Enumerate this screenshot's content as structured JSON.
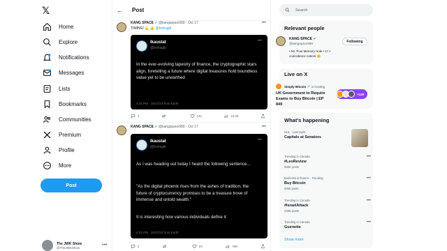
{
  "nav": {
    "logo": "𝕏",
    "items": [
      {
        "label": "Home",
        "icon": "home-icon"
      },
      {
        "label": "Explore",
        "icon": "search-icon"
      },
      {
        "label": "Notifications",
        "icon": "bell-icon"
      },
      {
        "label": "Messages",
        "icon": "mail-icon"
      },
      {
        "label": "Lists",
        "icon": "list-icon"
      },
      {
        "label": "Bookmarks",
        "icon": "bookmark-icon"
      },
      {
        "label": "Communities",
        "icon": "people-icon"
      },
      {
        "label": "Premium",
        "icon": "x-logo-icon"
      },
      {
        "label": "Profile",
        "icon": "person-icon"
      },
      {
        "label": "More",
        "icon": "more-circle-icon"
      }
    ],
    "post_button": "Post",
    "account": {
      "name": "The JWK Show",
      "handle": "@TheJWKShow"
    }
  },
  "center": {
    "title": "Post",
    "tweets": [
      {
        "author": "KANG SPACE",
        "handle": "@kangspace589",
        "date": "Oct 17",
        "text": "TIMING! 💪 👍",
        "mention": "@trohsgib",
        "quote": {
          "name": "Ikaustat",
          "handle": "@trohsgib",
          "body": "In the ever-evolving tapestry of finance, the cryptographic stars align, foretelling a future where digital treasures hold boundless value yet to be unearthed",
          "footer": "4:33 PM · 10/17/23 from Earth"
        },
        "actions": {
          "replies": "2",
          "reposts": "",
          "likes": "141",
          "views": "12.0K"
        }
      },
      {
        "author": "KANG SPACE",
        "handle": "@kangspace589",
        "date": "Oct 17",
        "quote": {
          "name": "Ikaustat",
          "handle": "@trohsgib",
          "p1": "As I was heading out today I heard the following sentence...",
          "p2": "\"As the digital phoenix rises from the ashes of tradition, the future of cryptocurrency promises to be a treasure trove of immense and untold wealth.\"",
          "p3": "It is interesting how various individuals define it",
          "footer": "4:33 PM · 10/17/23 from Earth"
        },
        "actions": {
          "replies": "2",
          "reposts": "",
          "likes": "24",
          "views": "75K"
        }
      }
    ]
  },
  "right": {
    "search_placeholder": "Search",
    "relevant": {
      "title": "Relevant people",
      "name": "KANG SPACE",
      "handle": "@kangspace589",
      "bio": "• Mr. Pool Memory Hole • 17 • coincidence noticer 🙂",
      "follow_label": "Following"
    },
    "live": {
      "title": "Live on X",
      "host": "Simply Bitcoin",
      "status": "is hosting",
      "space_title": "UK Government to Require Exams to Buy Bitcoin | EP 849",
      "listeners": "+129"
    },
    "happening": {
      "title": "What's happening",
      "trends": [
        {
          "context": "NHL · Last night",
          "name": "Capitals at Senators",
          "posts": ""
        },
        {
          "context": "Trending in Canada",
          "name": "#LeoReview",
          "posts": "355K posts"
        },
        {
          "context": "Business & finance · Trending",
          "name": "Buy Bitcoin",
          "posts": "6365 posts"
        },
        {
          "context": "Trending in Canada",
          "name": "#IsraelAttack",
          "posts": "233K posts"
        },
        {
          "context": "Trending in Canada",
          "name": "Guenette",
          "posts": ""
        }
      ],
      "show_more": "Show more"
    }
  }
}
